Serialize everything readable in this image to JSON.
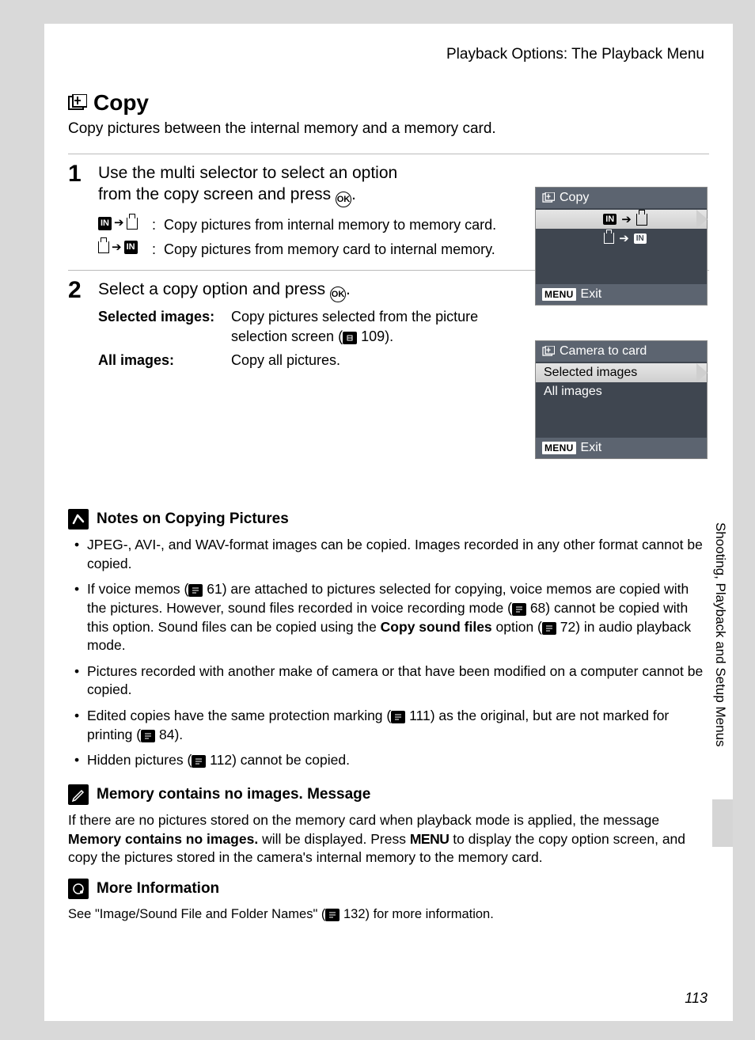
{
  "running_head": "Playback Options: The Playback Menu",
  "section": {
    "title": "Copy",
    "intro": "Copy pictures between the internal memory and a memory card."
  },
  "steps": [
    {
      "num": "1",
      "text_a": "Use the multi selector to select an option",
      "text_b": "from the copy screen and press ",
      "ok": "OK",
      "items": [
        {
          "desc": "Copy pictures from internal memory to memory card."
        },
        {
          "desc": "Copy pictures from memory card to internal memory."
        }
      ]
    },
    {
      "num": "2",
      "text_a": "Select a copy option and press ",
      "ok": "OK",
      "defs": [
        {
          "term": "Selected images",
          "desc_a": "Copy pictures selected from the picture selection screen (",
          "ref": "109",
          "desc_b": ")."
        },
        {
          "term": "All images",
          "desc": "Copy all pictures."
        }
      ]
    }
  ],
  "screens": {
    "s1": {
      "title": "Copy",
      "footer": "Exit",
      "menu": "MENU"
    },
    "s2": {
      "title": "Camera to card",
      "row1": "Selected images",
      "row2": "All images",
      "footer": "Exit",
      "menu": "MENU"
    }
  },
  "notes": {
    "h1": "Notes on Copying Pictures",
    "b1a": "JPEG-, AVI-, and WAV-format images can be copied. Images recorded in any other format cannot be copied.",
    "b2a": "If voice memos (",
    "b2r1": "61",
    "b2b": ") are attached to pictures selected for copying, voice memos are copied with the pictures. However, sound files recorded in voice recording mode (",
    "b2r2": "68",
    "b2c": ") cannot be copied with this option. Sound files can be copied using the ",
    "b2bold": "Copy sound files",
    "b2d": " option (",
    "b2r3": "72",
    "b2e": ") in audio playback mode.",
    "b3": "Pictures recorded with another make of camera or that have been modified on a computer cannot be copied.",
    "b4a": "Edited copies have the same protection marking (",
    "b4r1": "111",
    "b4b": ") as the original, but are not marked for printing (",
    "b4r2": "84",
    "b4c": ").",
    "b5a": "Hidden pictures (",
    "b5r1": "112",
    "b5b": ") cannot be copied."
  },
  "mem": {
    "h": "Memory contains no images. Message",
    "p1": "If there are no pictures stored on the memory card when playback mode is applied, the message ",
    "bold": "Memory contains no images.",
    "p2": " will be displayed. Press ",
    "menu": "MENU",
    "p3": " to display the copy option screen, and copy the pictures stored in the camera's internal memory to the memory card."
  },
  "more": {
    "h": "More Information",
    "p1": "See \"Image/Sound File and Folder Names\" (",
    "ref": "132",
    "p2": ") for more information."
  },
  "side_label": "Shooting, Playback and Setup Menus",
  "page_number": "113"
}
